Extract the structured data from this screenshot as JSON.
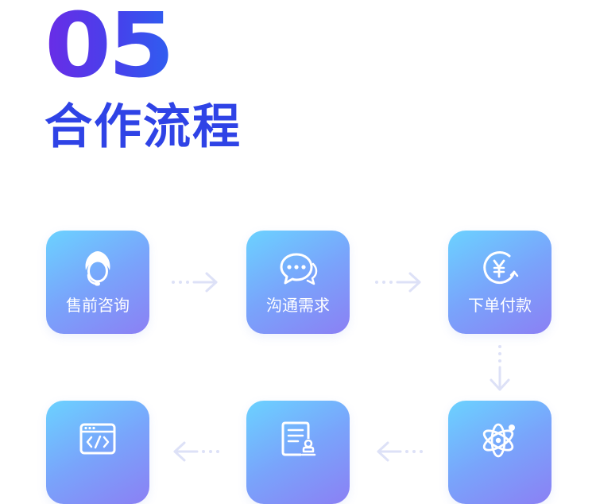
{
  "section": {
    "number": "05",
    "title": "合作流程"
  },
  "steps": [
    {
      "label": "售前咨询",
      "icon": "consultant-icon"
    },
    {
      "label": "沟通需求",
      "icon": "chat-bubbles-icon"
    },
    {
      "label": "下单付款",
      "icon": "yen-payment-icon"
    },
    {
      "label": "",
      "icon": "atom-icon"
    },
    {
      "label": "",
      "icon": "document-seal-icon"
    },
    {
      "label": "",
      "icon": "code-window-icon"
    }
  ],
  "colors": {
    "accent": "#2f43e6",
    "number_start": "#6a2ce6",
    "card_top": "#6bd2ff",
    "card_bottom": "#8b80f4",
    "arrow": "#dde1f7"
  }
}
